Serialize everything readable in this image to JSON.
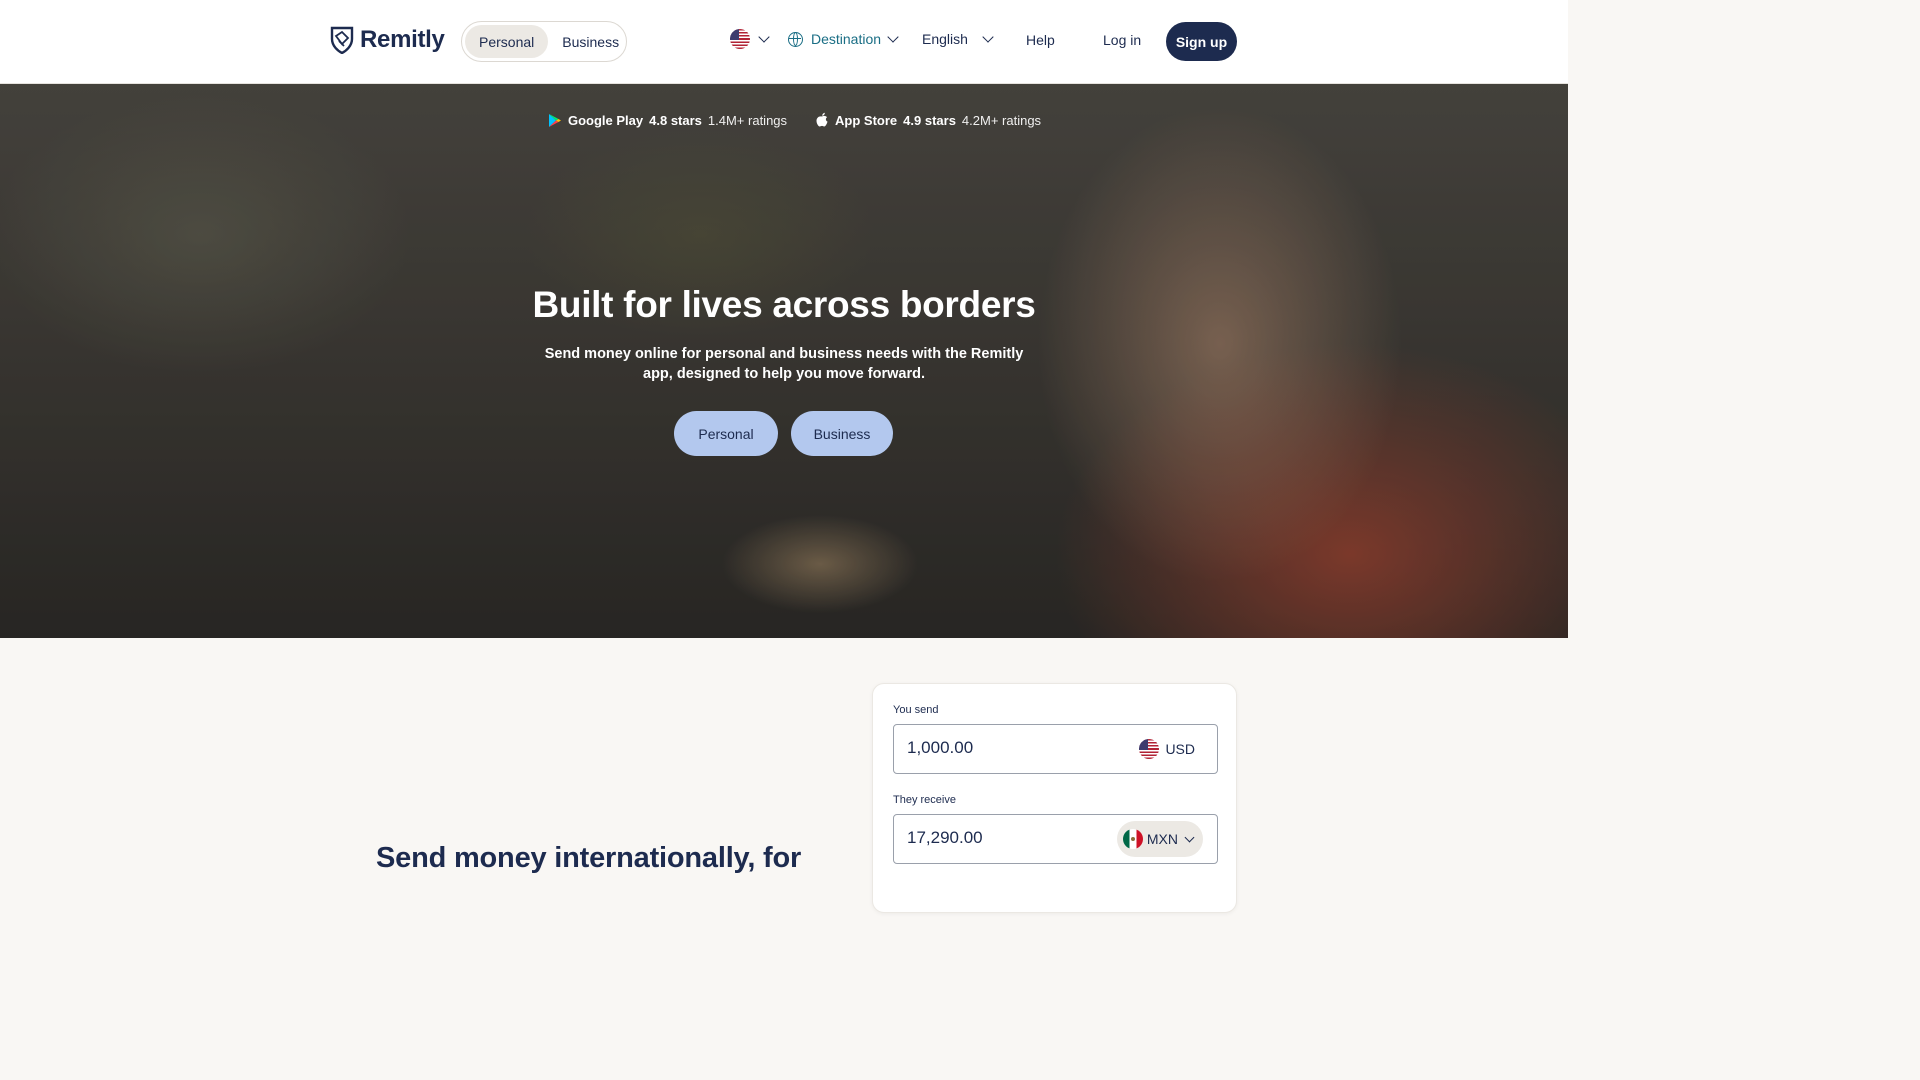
{
  "header": {
    "brand": "Remitly",
    "segments": [
      {
        "label": "Personal",
        "active": true
      },
      {
        "label": "Business",
        "active": false
      }
    ],
    "country_flag": "us-flag-icon",
    "destination_label": "Destination",
    "language_label": "English",
    "help_label": "Help",
    "login_label": "Log in",
    "signup_label": "Sign up"
  },
  "ratings": [
    {
      "store": "Google Play",
      "score": "4.8 stars",
      "count": "1.4M+ ratings",
      "icon": "google-play-icon"
    },
    {
      "store": "App Store",
      "score": "4.9 stars",
      "count": "4.2M+ ratings",
      "icon": "apple-icon"
    }
  ],
  "hero": {
    "title": "Built for lives across borders",
    "subtitle": "Send money online for personal and business needs with the Remitly app, designed to help you move forward.",
    "buttons": [
      "Personal",
      "Business"
    ]
  },
  "lower": {
    "heading": "Send money internationally, for"
  },
  "calculator": {
    "send_label": "You send",
    "send_value": "1,000.00",
    "send_currency": "USD",
    "receive_label": "They receive",
    "receive_value": "17,290.00",
    "receive_currency": "MXN"
  },
  "colors": {
    "brand_navy": "#1d2b4f",
    "accent_teal": "#1a6e85",
    "hero_button": "#b3c8ee",
    "page_bg": "#f9f7f4"
  }
}
